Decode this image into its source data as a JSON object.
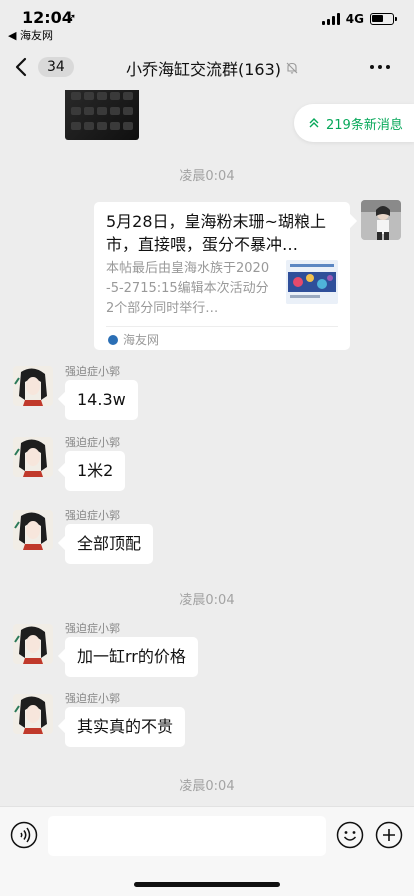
{
  "status_bar": {
    "time": "12:04",
    "back_app": "◀ 海友网",
    "network": "4G"
  },
  "nav": {
    "back_count": "34",
    "title": "小乔海缸交流群(163)",
    "icons": {
      "back": "chevron-left-icon",
      "mute": "mute-bell-icon",
      "more": "more-dots-icon"
    }
  },
  "chat": {
    "new_messages_label": "219条新消息",
    "timestamps": [
      "凌晨0:04",
      "凌晨0:04",
      "凌晨0:04"
    ],
    "link_card": {
      "title": "5月28日，皇海粉末珊~瑚粮上市，直接喂，蛋分不暴冲…",
      "description": "本帖最后由皇海水族于2020-5-2715:15编辑本次活动分2个部分同时举行…",
      "source": "海友网"
    },
    "messages": [
      {
        "sender": "强迫症小郭",
        "text": "14.3w"
      },
      {
        "sender": "强迫症小郭",
        "text": "1米2"
      },
      {
        "sender": "强迫症小郭",
        "text": "全部顶配"
      },
      {
        "sender": "强迫症小郭",
        "text": "加一缸rr的价格"
      },
      {
        "sender": "强迫症小郭",
        "text": "其实真的不贵"
      }
    ]
  },
  "input_bar": {
    "value": "",
    "icons": {
      "voice": "voice-icon",
      "emoji": "emoji-icon",
      "plus": "plus-icon"
    }
  },
  "colors": {
    "background": "#ededed",
    "accent_green": "#07a85a",
    "bubble": "#ffffff",
    "timestamp": "#a3a3a3"
  }
}
